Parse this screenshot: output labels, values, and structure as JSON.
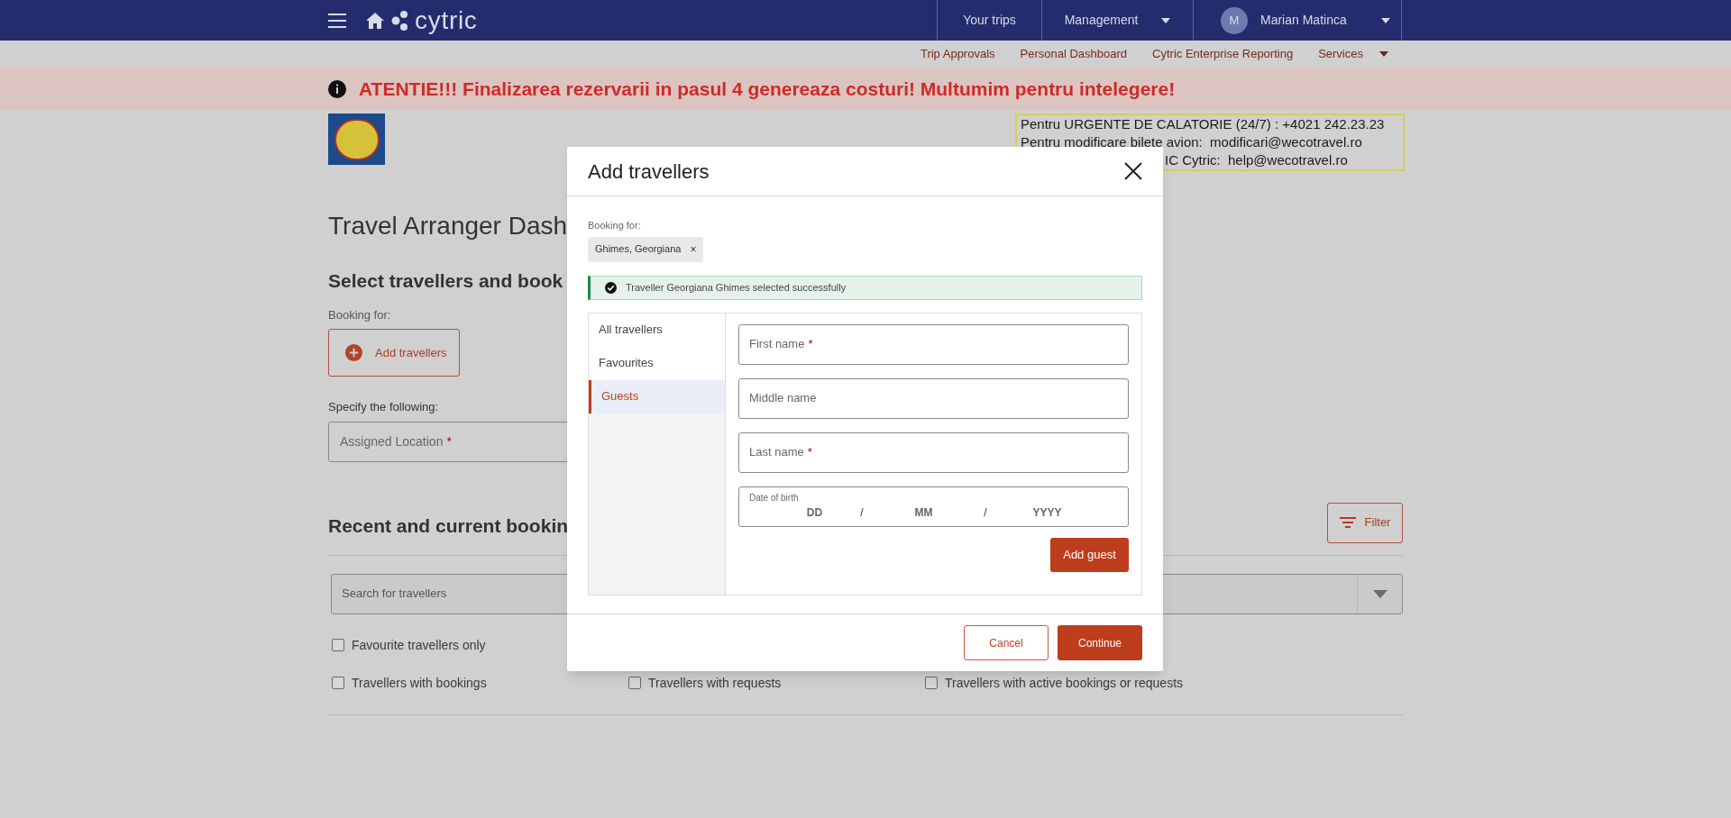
{
  "navbar": {
    "logo": "cytric",
    "items": [
      {
        "label": "Your trips",
        "has_menu": false
      },
      {
        "label": "Management",
        "has_menu": true
      }
    ],
    "user": {
      "avatar": "M",
      "name": "Marian Matinca"
    }
  },
  "subnav": [
    {
      "label": "Trip Approvals",
      "has_menu": false
    },
    {
      "label": "Personal Dashboard",
      "has_menu": false
    },
    {
      "label": "Cytric Enterprise Reporting",
      "has_menu": false
    },
    {
      "label": "Services",
      "has_menu": true
    }
  ],
  "banner": "ATENTIE!!! Finalizarea rezervarii in pasul 4 genereaza costuri! Multumim pentru intelegere!",
  "contact_box": [
    "Pentru URGENTE DE CALATORIE (24/7) : +4021 242.23.23",
    "Pentru modificare bilete avion:  modificari@wecotravel.ro",
    "IC Cytric:  help@wecotravel.ro"
  ],
  "page": {
    "title": "Travel Arranger Dash",
    "section_title": "Select travellers and book",
    "booking_for_label": "Booking for:",
    "add_travellers_button": "Add travellers",
    "specify_label": "Specify the following:",
    "assigned_location": {
      "placeholder": "Assigned Location",
      "required_mark": "*"
    },
    "bookings_title": "Recent and current bookin",
    "filter_button": "Filter",
    "search": {
      "placeholder": "Search for travellers"
    },
    "checkboxes": [
      {
        "label": "Favourite travellers only",
        "checked": false
      },
      {
        "label": "Travellers with bookings",
        "checked": false
      },
      {
        "label": "Travellers with requests",
        "checked": false
      },
      {
        "label": "Travellers with active bookings or requests",
        "checked": false
      }
    ]
  },
  "dialog": {
    "title": "Add travellers",
    "booking_for_label": "Booking for:",
    "chips": [
      {
        "label": "Ghimes, Georgiana",
        "remove": "×"
      }
    ],
    "alert": "Traveller Georgiana Ghimes selected successfully",
    "tabs": [
      {
        "label": "All travellers",
        "selected": false
      },
      {
        "label": "Favourites",
        "selected": false
      },
      {
        "label": "Guests",
        "selected": true
      }
    ],
    "fields": [
      {
        "placeholder": "First name",
        "required_mark": "*"
      },
      {
        "placeholder": "Middle name"
      },
      {
        "placeholder": "Last name",
        "required_mark": "*"
      }
    ],
    "date_of_birth": {
      "label": "Date of birth",
      "parts": [
        "DD",
        "MM",
        "YYYY"
      ],
      "separator": "/"
    },
    "add_guest_button": "Add guest",
    "cancel_button": "Cancel",
    "continue_button": "Continue"
  }
}
